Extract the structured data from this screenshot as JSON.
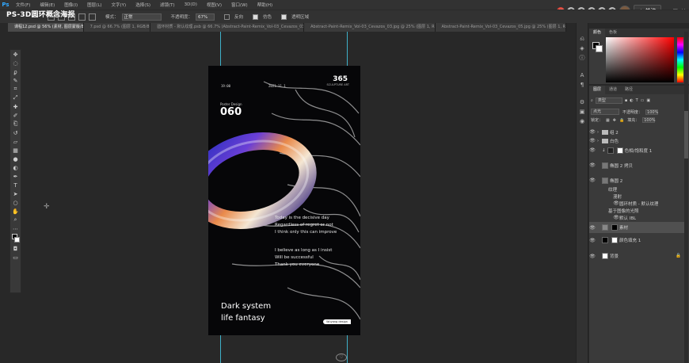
{
  "app": {
    "logo": "Ps",
    "title_overlay": "PS-3D圆环概念海报",
    "menus": [
      "文件(F)",
      "编辑(E)",
      "图像(I)",
      "图层(L)",
      "文字(Y)",
      "选择(S)",
      "滤镜(T)",
      "3D(D)",
      "视图(V)",
      "窗口(W)",
      "帮助(H)"
    ]
  },
  "header_right": {
    "follow": "+ 关注",
    "controls": [
      "—",
      "□",
      "✕"
    ]
  },
  "options": {
    "mode_label": "模式：",
    "mode_value": "正常",
    "opacity_label": "不透明度：",
    "opacity_value": "67%",
    "reverse_label": "反向",
    "dither_label": "仿色",
    "transparency_label": "透明区域"
  },
  "tabs": [
    "课程12.psd @ 56% (素材, 图层蒙版/8) *",
    "7.psd @ 66.7% (图层 1, RGB/8) *",
    "圆环材质 - 默认纹理.psb @ 66.7% (Abstract-Paint-Remix_Vol-03_Cevazos_03, RGB/8) *",
    "Abstract-Paint-Remix_Vol-03_Cevazos_03.jpg @ 25% (图层 1, RGB/8*) *",
    "Abstract-Paint-Remix_Vol-03_Cevazos_05.jpg @ 25% (图层 1, RGB/8*) *"
  ],
  "tools": [
    "move",
    "marquee",
    "lasso",
    "quick-select",
    "crop",
    "eyedropper",
    "heal",
    "brush",
    "stamp",
    "history-brush",
    "eraser",
    "gradient",
    "blur",
    "dodge",
    "pen",
    "type",
    "path-select",
    "shape",
    "hand",
    "zoom",
    "more",
    "quick-mask",
    "screen-mode"
  ],
  "poster": {
    "header_left": "19:00",
    "header_mid": "2021.11.1",
    "number": "365",
    "number_sub": "SCULPTURE ART",
    "poster_design": "Poster Design",
    "issue": "060",
    "quote1": [
      "Today is the decisive day",
      "Regardless of regret or not",
      "I think only this can improve"
    ],
    "quote2": [
      "I believe as long as I insist",
      "Will be successful",
      "Thank you everyone"
    ],
    "title_lines": [
      "Dark system",
      "life fantasy"
    ],
    "signature": "Wuyang design"
  },
  "color_panel": {
    "tabs": [
      "颜色",
      "色板"
    ]
  },
  "layers_panel": {
    "tabs": [
      "图层",
      "通道",
      "路径"
    ],
    "filter_label": "类型",
    "blend_mode": "点光",
    "opacity_label": "不透明度：",
    "opacity_value": "100%",
    "lock_label": "锁定：",
    "fill_label": "填充：",
    "fill_value": "100%",
    "layers": [
      {
        "name": "组 2",
        "kind": "folder"
      },
      {
        "name": "白色",
        "kind": "folder"
      },
      {
        "name": "色相/饱和度 1",
        "kind": "adjust"
      },
      {
        "name": "椭圆 2 拷贝",
        "kind": "shape"
      },
      {
        "name": "椭圆 2",
        "kind": "shape"
      },
      {
        "name": "纹理",
        "kind": "effect"
      },
      {
        "name": "漫射",
        "kind": "effect"
      },
      {
        "name": "圆环材质 - 默认纹理",
        "kind": "effect"
      },
      {
        "name": "基于图像的光照",
        "kind": "effect"
      },
      {
        "name": "默认 IBL",
        "kind": "effect"
      },
      {
        "name": "素材",
        "kind": "image"
      },
      {
        "name": "颜色填充 1",
        "kind": "fill"
      },
      {
        "name": "背景",
        "kind": "bg"
      }
    ]
  }
}
